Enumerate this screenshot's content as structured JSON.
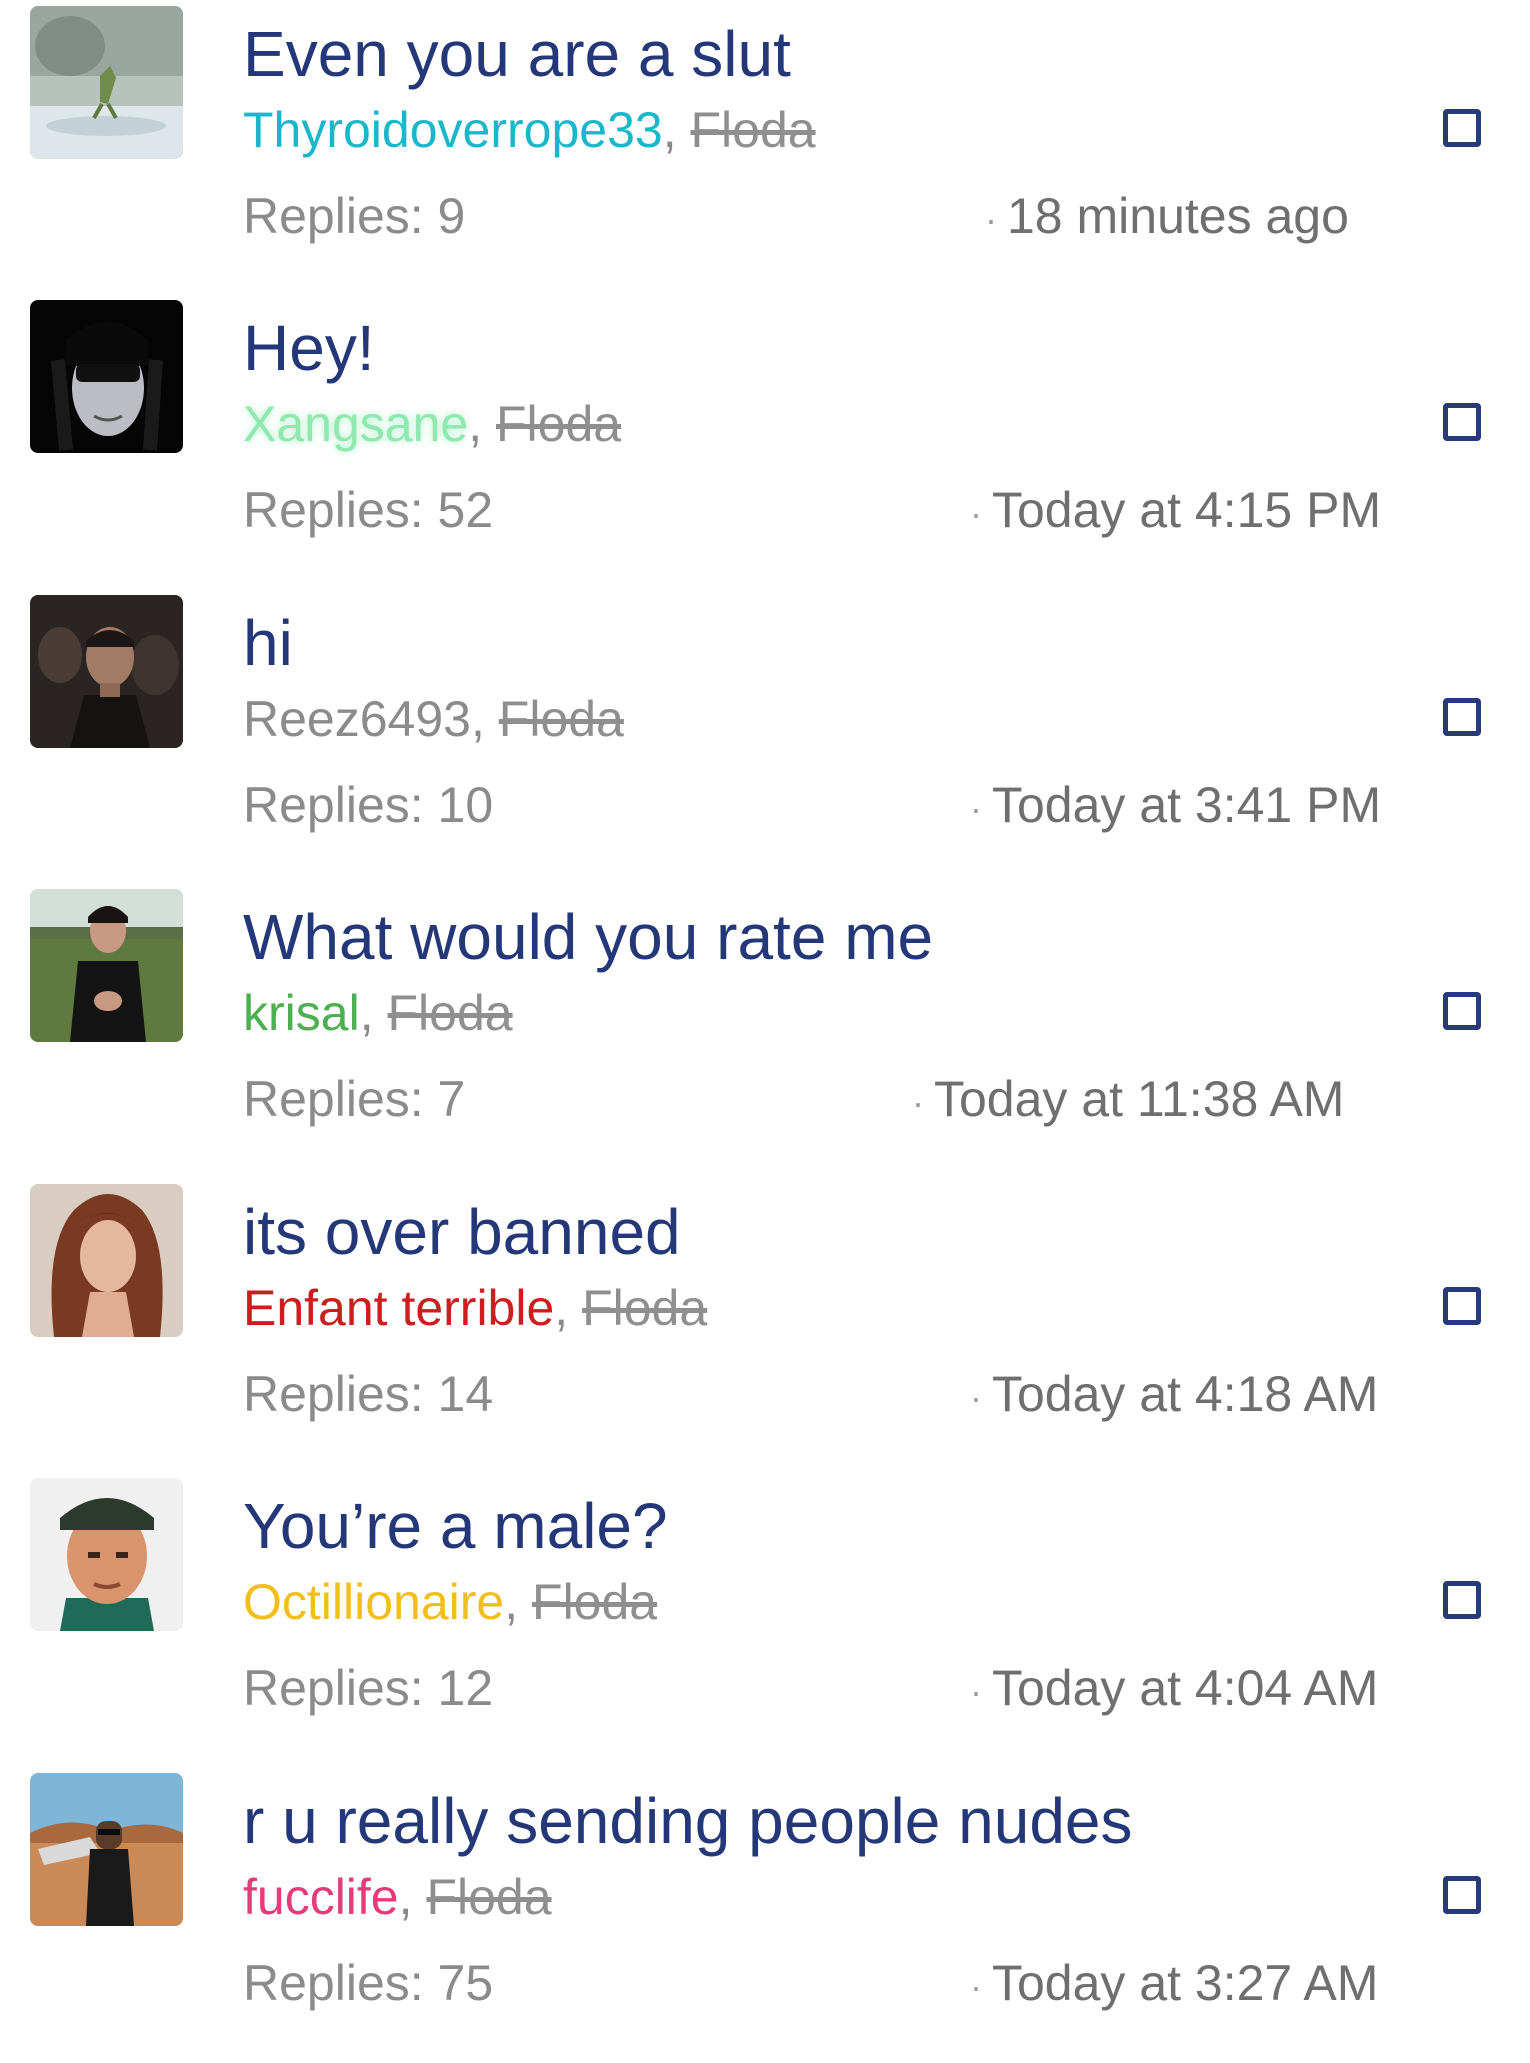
{
  "threads": [
    {
      "title": "Even you are a slut",
      "author": "Thyroidoverrope33",
      "author_color": "#18b7c9",
      "separator": ",",
      "last_poster": "Floda",
      "replies": "Replies: 9",
      "time": "18 minutes ago"
    },
    {
      "title": "Hey!",
      "author": "Xangsane",
      "author_color": "#8fe8b0",
      "separator": ",",
      "last_poster": "Floda",
      "replies": "Replies: 52",
      "time": "Today at 4:15 PM"
    },
    {
      "title": "hi",
      "author": "Reez6493",
      "author_color": "#8b8b8b",
      "separator": ",",
      "last_poster": "Floda",
      "replies": "Replies: 10",
      "time": "Today at 3:41 PM"
    },
    {
      "title": "What would you rate me",
      "author": "krisal",
      "author_color": "#4caf50",
      "separator": ",",
      "last_poster": "Floda",
      "replies": "Replies: 7",
      "time": "Today at 11:38 AM"
    },
    {
      "title": "its over banned",
      "author": "Enfant terrible",
      "author_color": "#cc1e1e",
      "separator": ",",
      "last_poster": "Floda",
      "replies": "Replies: 14",
      "time": "Today at 4:18 AM"
    },
    {
      "title": "You’re a male?",
      "author": "Octillionaire",
      "author_color": "#f2be1a",
      "separator": ",",
      "last_poster": "Floda",
      "replies": "Replies: 12",
      "time": "Today at 4:04 AM"
    },
    {
      "title": "r u really sending people nudes",
      "author": "fucclife",
      "author_color": "#e63b7a",
      "separator": ",",
      "last_poster": "Floda",
      "replies": "Replies: 75",
      "time": "Today at 3:27 AM"
    }
  ],
  "time_separator": "·"
}
